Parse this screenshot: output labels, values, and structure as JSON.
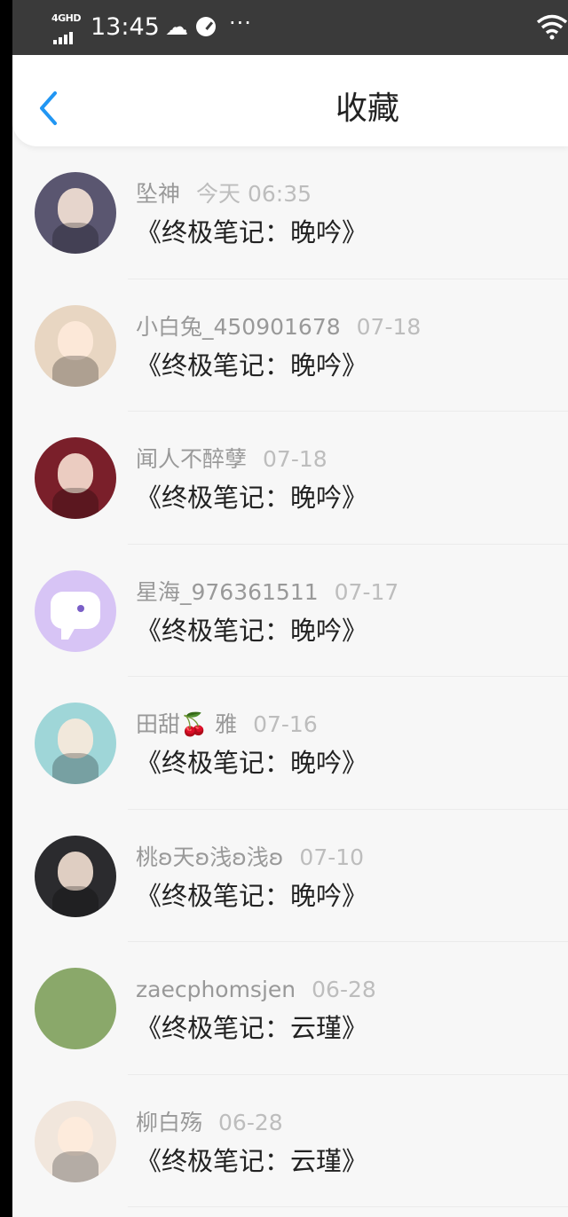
{
  "status_bar": {
    "network": "4GHD",
    "time": "13:45",
    "icons": [
      "signal-icon",
      "cloud-icon",
      "gauge-icon",
      "more-icon",
      "wifi-icon"
    ],
    "more": "···"
  },
  "header": {
    "title": "收藏",
    "back_icon": "chevron-left-icon",
    "accent": "#2196f3"
  },
  "items": [
    {
      "name": "坠神",
      "date": "今天 06:35",
      "title": "《终极笔记：晚吟》",
      "avatar_color": "#5a5670"
    },
    {
      "name": "小白兔_450901678",
      "date": "07-18",
      "title": "《终极笔记：晚吟》",
      "avatar_color": "#e8d6c2"
    },
    {
      "name": "闻人不醉孽",
      "date": "07-18",
      "title": "《终极笔记：晚吟》",
      "avatar_color": "#7a1f2a"
    },
    {
      "name": "星海_976361511",
      "date": "07-17",
      "title": "《终极笔记：晚吟》",
      "avatar_color": "#d7c4f5"
    },
    {
      "name": "田甜🍒 雅",
      "date": "07-16",
      "title": "《终极笔记：晚吟》",
      "avatar_color": "#9fd6d8"
    },
    {
      "name": "桃ʚ天ʚ浅ʚ浅ʚ",
      "date": "07-10",
      "title": "《终极笔记：晚吟》",
      "avatar_color": "#2b2b2e"
    },
    {
      "name": "zaecphomsjen",
      "date": "06-28",
      "title": "《终极笔记：云瑾》",
      "avatar_color": "#8aa86a"
    },
    {
      "name": "柳白殇",
      "date": "06-28",
      "title": "《终极笔记：云瑾》",
      "avatar_color": "#f1e6dc"
    }
  ]
}
